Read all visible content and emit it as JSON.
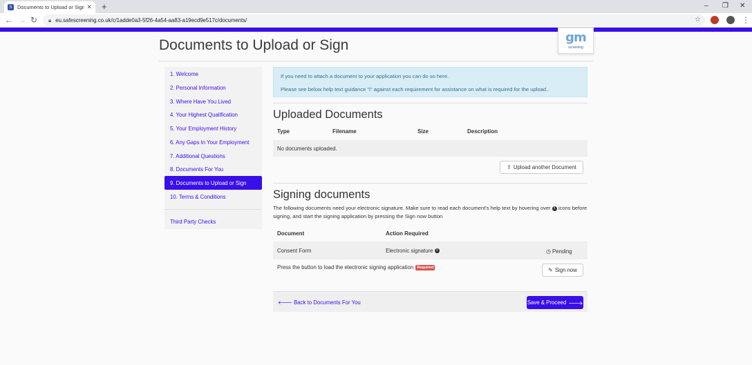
{
  "browser": {
    "tab_title": "Documents to Upload or Sign - ",
    "favicon_letter": "S",
    "new_tab": "+",
    "url": "eu.safescreening.co.uk/c/1adde0a3-5f26-4a54-aa83-a19ecd9e517c/documents/"
  },
  "colors": {
    "brand": "#3a0ee8",
    "info_bg": "#d9edf7",
    "required": "#d9534f"
  },
  "page": {
    "title": "Documents to Upload or Sign",
    "logo_mark": "gm",
    "logo_sub": "screening"
  },
  "sidebar": {
    "items": [
      {
        "label": "1. Welcome"
      },
      {
        "label": "2. Personal Information"
      },
      {
        "label": "3. Where Have You Lived"
      },
      {
        "label": "4. Your Highest Qualification"
      },
      {
        "label": "5. Your Employment History"
      },
      {
        "label": "6. Any Gaps In Your Employment"
      },
      {
        "label": "7. Additional Questions"
      },
      {
        "label": "8. Documents For You"
      },
      {
        "label": "9. Documents to Upload or Sign"
      },
      {
        "label": "10. Terms & Conditions"
      }
    ],
    "extra": "Third Party Checks"
  },
  "info": {
    "line1": "If you need to attach a document to your application you can do so here.",
    "line2": "Please see below help text guidance \"i\" against each requirement for assistance on what is required for the upload.."
  },
  "uploaded": {
    "title": "Uploaded Documents",
    "columns": [
      "Type",
      "Filename",
      "Size",
      "Description"
    ],
    "empty": "No documents uploaded.",
    "upload_button": "Upload another Document"
  },
  "signing": {
    "title": "Signing documents",
    "desc_part1": "The following documents need your electronic signature. Make sure to read each document's help text by hovering over",
    "desc_part2": "icons before signing, and start the signing application by pressing the Sign now button",
    "columns": [
      "Document",
      "Action Required"
    ],
    "row": {
      "document": "Consent Form",
      "action": "Electronic signature",
      "status": "Pending"
    },
    "press_text": "Press the button to load the electronic signing application",
    "required_badge": "Required",
    "sign_button": "Sign now"
  },
  "footer": {
    "back": "Back to Documents For You",
    "proceed": "Save & Proceed"
  }
}
